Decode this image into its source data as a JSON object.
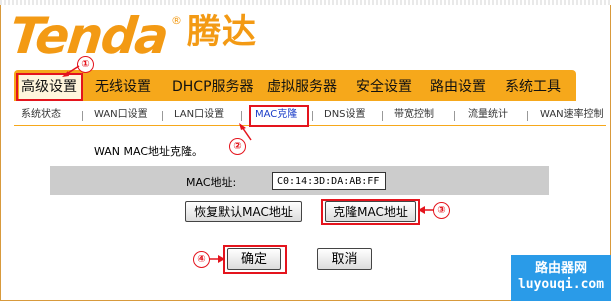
{
  "brand": {
    "logo_text": "Tenda",
    "logo_cn": "腾达",
    "reg": "®"
  },
  "main_menu": [
    "高级设置",
    "无线设置",
    "DHCP服务器",
    "虚拟服务器",
    "安全设置",
    "路由设置",
    "系统工具"
  ],
  "sub_menu": [
    "系统状态",
    "WAN口设置",
    "LAN口设置",
    "MAC克隆",
    "DNS设置",
    "带宽控制",
    "流量统计",
    "WAN速率控制"
  ],
  "content": {
    "description": "WAN MAC地址克隆。",
    "mac_label": "MAC地址:",
    "mac_value": "C0:14:3D:DA:AB:FF",
    "restore_button": "恢复默认MAC地址",
    "clone_button": "克隆MAC地址",
    "ok_button": "确定",
    "cancel_button": "取消"
  },
  "markers": [
    "①",
    "②",
    "③",
    "④"
  ],
  "watermark": {
    "top": "路由器网",
    "bottom": "luyouqi.com"
  },
  "colors": {
    "accent": "#f6a81b",
    "logo": "#f39a14",
    "annotation": "#e4141d",
    "watermark": "#2a9be8"
  }
}
